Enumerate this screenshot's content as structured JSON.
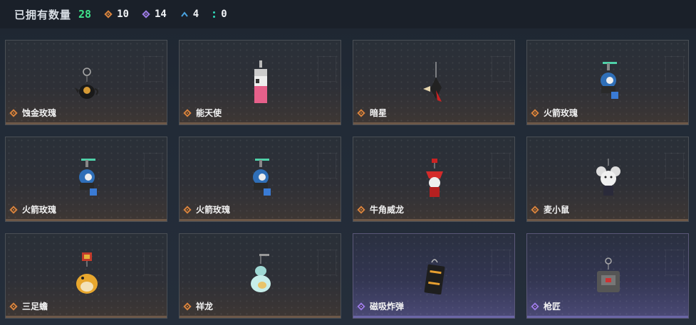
{
  "header": {
    "title": "已拥有数量",
    "total": "28",
    "stats": [
      {
        "icon": "orange-diamond-icon",
        "color": "#d9833d",
        "count": "10"
      },
      {
        "icon": "purple-diamond-icon",
        "color": "#9b7be8",
        "count": "14"
      },
      {
        "icon": "blue-chevron-icon",
        "color": "#4aa3e0",
        "count": "4"
      },
      {
        "icon": "teal-colon-icon",
        "color": "#2fd7b8",
        "count": "0"
      }
    ]
  },
  "items": [
    {
      "name": "蚀金玫瑰",
      "rarity": "orange"
    },
    {
      "name": "能天使",
      "rarity": "orange"
    },
    {
      "name": "暗星",
      "rarity": "orange"
    },
    {
      "name": "火箭玫瑰",
      "rarity": "orange"
    },
    {
      "name": "火箭玫瑰",
      "rarity": "orange"
    },
    {
      "name": "火箭玫瑰",
      "rarity": "orange"
    },
    {
      "name": "牛角威龙",
      "rarity": "orange"
    },
    {
      "name": "麦小鼠",
      "rarity": "orange"
    },
    {
      "name": "三足蟾",
      "rarity": "orange"
    },
    {
      "name": "祥龙",
      "rarity": "orange"
    },
    {
      "name": "磁吸炸弹",
      "rarity": "purple"
    },
    {
      "name": "枪匠",
      "rarity": "purple"
    }
  ]
}
